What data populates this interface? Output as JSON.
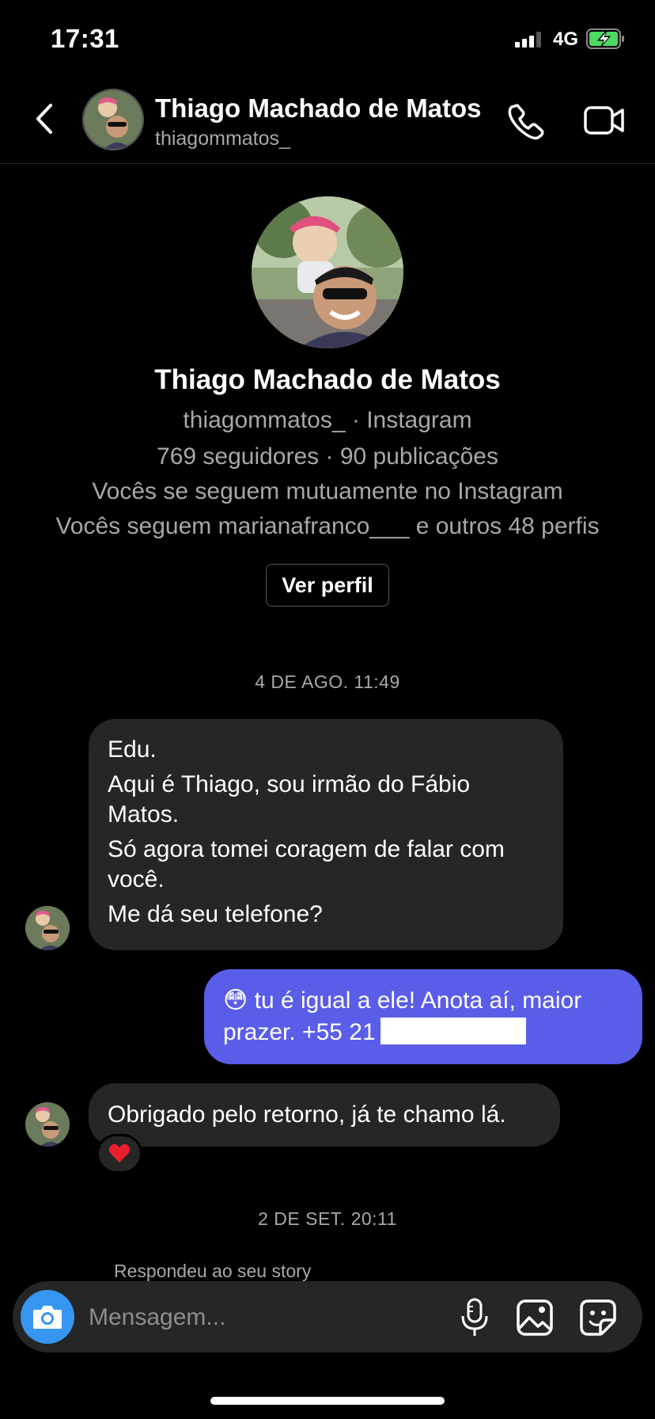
{
  "status_bar": {
    "time": "17:31",
    "network": "4G"
  },
  "header": {
    "name": "Thiago Machado de Matos",
    "username": "thiagommatos_"
  },
  "profile": {
    "name": "Thiago Machado de Matos",
    "subtitle": "thiagommatos_ · Instagram",
    "stats": "769 seguidores · 90 publicações",
    "mutual_follow": "Vocês se seguem mutuamente no Instagram",
    "mutual_friends": "Vocês seguem marianafranco___ e outros 48 perfis",
    "view_profile_label": "Ver perfil"
  },
  "conversation": {
    "timestamp_1": "4 DE AGO. 11:49",
    "incoming_1": {
      "lines": [
        "Edu.",
        "Aqui é Thiago, sou irmão do Fábio",
        "Matos.",
        "Só agora tomei coragem de falar com",
        "você.",
        "Me dá seu telefone?"
      ]
    },
    "outgoing_1": {
      "line_1": "😳 tu é igual a ele! Anota aí, maior",
      "line_2": "prazer. +55 21"
    },
    "incoming_2": {
      "text": "Obrigado pelo retorno, já te chamo lá."
    },
    "reaction_icon": "heart-emoji",
    "timestamp_2": "2 DE SET. 20:11",
    "story_reply_label": "Respondeu ao seu story"
  },
  "composer": {
    "placeholder": "Mensagem..."
  },
  "colors": {
    "background": "#000000",
    "incoming_bubble": "#262626",
    "outgoing_bubble": "#5a5de8",
    "camera_button": "#3797f0",
    "battery_charging": "#4cd964",
    "secondary_text": "#a8a8a8"
  },
  "icons": [
    "back-icon",
    "phone-icon",
    "video-icon",
    "camera-icon",
    "microphone-icon",
    "gallery-icon",
    "sticker-icon",
    "heart-icon"
  ]
}
